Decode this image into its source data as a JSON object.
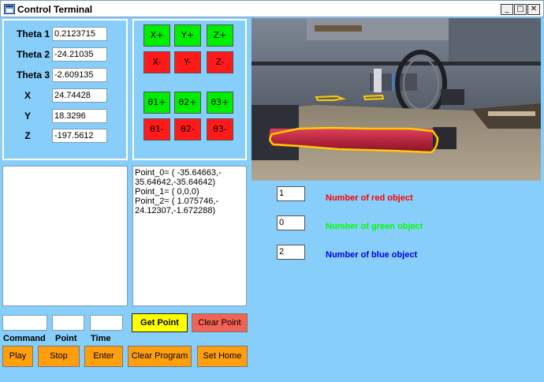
{
  "window": {
    "title": "Control Terminal",
    "minimize_glyph": "_",
    "maximize_glyph": "□",
    "close_glyph": "✕"
  },
  "coordinates": [
    {
      "label": "Theta 1",
      "value": "0.2123715"
    },
    {
      "label": "Theta 2",
      "value": "-24.21035"
    },
    {
      "label": "Theta 3",
      "value": "-2.609135"
    },
    {
      "label": "X",
      "value": "24.74428"
    },
    {
      "label": "Y",
      "value": "18.3296"
    },
    {
      "label": "Z",
      "value": "-197.5612"
    }
  ],
  "jog": {
    "cartesian_plus": [
      "X+",
      "Y+",
      "Z+"
    ],
    "cartesian_minus": [
      "X-",
      "Y-",
      "Z-"
    ],
    "joint_plus": [
      "θ1+",
      "θ2+",
      "θ3+"
    ],
    "joint_minus": [
      "θ1-",
      "θ2-",
      "θ3-"
    ],
    "plus_color": "#00ee00",
    "minus_color": "#ff1a1a"
  },
  "points_log": [
    "Point_0= ( -35.64663,-",
    "35.64642,-35.64642)",
    "Point_1= ( 0,0,0)",
    "Point_2= ( 1.075746,-",
    "24.12307,-1.672288)"
  ],
  "objects": [
    {
      "count": "1",
      "label": "Number of red object",
      "color": "#ff0000"
    },
    {
      "count": "0",
      "label": "Number of green object",
      "color": "#00ff00"
    },
    {
      "count": "2",
      "label": "Number of blue object",
      "color": "#0000e0"
    }
  ],
  "program": {
    "command_label": "Command",
    "point_label": "Point",
    "time_label": "Time",
    "get_point": "Get Point",
    "clear_point": "Clear Point",
    "play": "Play",
    "stop": "Stop",
    "enter": "Enter",
    "clear_program": "Clear Program",
    "set_home": "Set Home",
    "get_point_color": "#ffff00",
    "clear_point_color": "#f26355",
    "action_color": "#ff9f0d"
  }
}
